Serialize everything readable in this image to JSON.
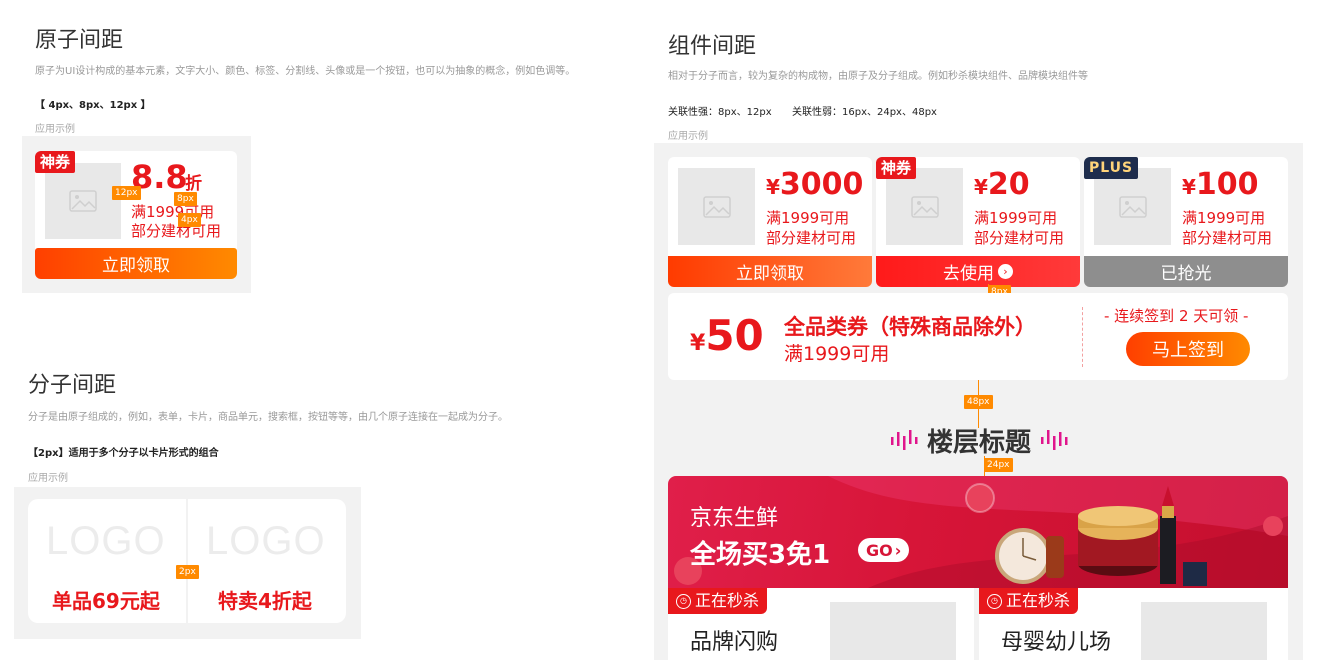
{
  "atom": {
    "title": "原子间距",
    "desc": "原子为UI设计构成的基本元素，文字大小、颜色、标签、分割线、头像或是一个按钮，也可以为抽象的概念，例如色调等。",
    "spacing": "【 4px、8px、12px 】",
    "example_label": "应用示例",
    "card": {
      "badge": "神券",
      "discount": "8.8",
      "discount_unit": "折",
      "cond1": "满1999可用",
      "cond2": "部分建材可用",
      "button": "立即领取",
      "tag12": "12px",
      "tag8": "8px",
      "tag4": "4px"
    }
  },
  "molecule": {
    "title": "分子间距",
    "desc": "分子是由原子组成的，例如，表单，卡片，商品单元，搜索框，按钮等等，由几个原子连接在一起成为分子。",
    "spacing": "【2px】适用于多个分子以卡片形式的组合",
    "example_label": "应用示例",
    "cards": [
      {
        "logo": "LOGO",
        "text": "单品69元起"
      },
      {
        "logo": "LOGO",
        "text": "特卖4折起"
      }
    ],
    "tag2": "2px"
  },
  "component": {
    "title": "组件间距",
    "desc": "相对于分子而言，较为复杂的构成物，由原子及分子组成。例如秒杀模块组件、品牌模块组件等",
    "strong": "关联性强：8px、12px",
    "weak": "关联性弱：16px、24px、48px",
    "example_label": "应用示例",
    "coupons": [
      {
        "badge": "",
        "price": "3000",
        "cond1": "满1999可用",
        "cond2": "部分建材可用",
        "button": "立即领取"
      },
      {
        "badge": "神券",
        "price": "20",
        "cond1": "满1999可用",
        "cond2": "部分建材可用",
        "button": "去使用"
      },
      {
        "badge": "PLUS",
        "price": "100",
        "cond1": "满1999可用",
        "cond2": "部分建材可用",
        "button": "已抢光"
      }
    ],
    "currency": "¥",
    "tag8": "8px",
    "wide_coupon": {
      "price": "50",
      "title": "全品类券（特殊商品除外）",
      "cond": "满1999可用",
      "signin_text": "- 连续签到 2 天可领 -",
      "signin_button": "马上签到"
    },
    "tag48": "48px",
    "floor_title": "楼层标题",
    "tag24": "24px",
    "banner": {
      "line1": "京东生鲜",
      "line2": "全场买3免1",
      "go": "GO"
    },
    "seckill": [
      {
        "label": "正在秒杀",
        "name": "品牌闪购"
      },
      {
        "label": "正在秒杀",
        "name": "母婴幼儿场"
      }
    ]
  },
  "colors": {
    "red": "#e8181c",
    "orange": "#ff8a00",
    "gray_bg": "#f2f2f2"
  }
}
